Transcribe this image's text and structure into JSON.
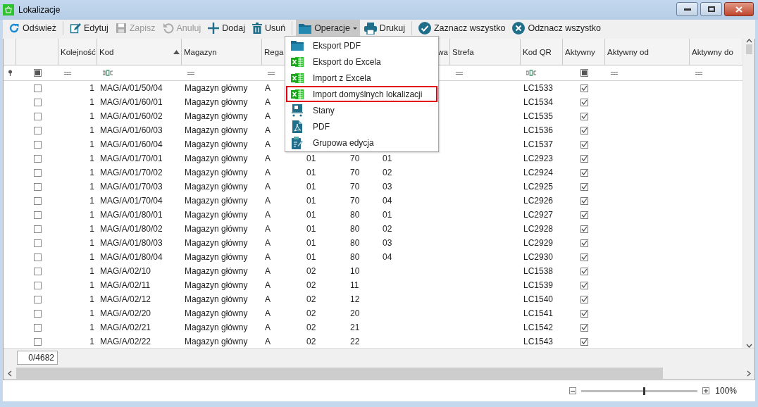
{
  "window": {
    "title": "Lokalizacje"
  },
  "toolbar": [
    {
      "kind": "button",
      "label": "Odśwież",
      "disabled": false
    },
    {
      "kind": "separator"
    },
    {
      "kind": "button",
      "label": "Edytuj",
      "disabled": false
    },
    {
      "kind": "button",
      "label": "Zapisz",
      "disabled": true
    },
    {
      "kind": "button",
      "label": "Anuluj",
      "disabled": true
    },
    {
      "kind": "button",
      "label": "Dodaj",
      "disabled": false
    },
    {
      "kind": "button",
      "label": "Usuń",
      "disabled": false
    },
    {
      "kind": "separator"
    },
    {
      "kind": "dropdown",
      "label": "Operacje",
      "disabled": false,
      "open": true
    },
    {
      "kind": "button",
      "label": "Drukuj",
      "disabled": false
    },
    {
      "kind": "separator"
    },
    {
      "kind": "button",
      "label": "Zaznacz wszystko",
      "disabled": false
    },
    {
      "kind": "button",
      "label": "Odznacz wszystko",
      "disabled": false
    }
  ],
  "menu": [
    {
      "label": "Eksport PDF",
      "selected": false
    },
    {
      "label": "Eksport do Excela",
      "selected": false
    },
    {
      "label": "Import z Excela",
      "selected": false
    },
    {
      "label": "Import domyślnych lokalizacji",
      "selected": true
    },
    {
      "label": "Stany",
      "selected": false
    },
    {
      "label": "PDF",
      "selected": false
    },
    {
      "label": "Grupowa edycja",
      "selected": false
    }
  ],
  "table": {
    "columns": [
      {
        "kind": "checkbox",
        "filter_indeterminate": true
      },
      {
        "kind": "number",
        "label": "Kolejność"
      },
      {
        "kind": "text",
        "label": "Kod",
        "sorted": true
      },
      {
        "kind": "text",
        "label": "Magazyn"
      },
      {
        "kind": "text",
        "label": "Rega"
      },
      {
        "kind": "text"
      },
      {
        "kind": "text"
      },
      {
        "kind": "text",
        "label": "wa"
      },
      {
        "kind": "text",
        "label": "Strefa"
      },
      {
        "kind": "text",
        "label": "Kod QR"
      },
      {
        "kind": "checkbox",
        "label": "Aktywny",
        "filter_indeterminate": true
      },
      {
        "kind": "text",
        "label": "Aktywny od"
      },
      {
        "kind": "text",
        "label": "Aktywny do"
      }
    ],
    "rows": [
      {
        "cells": [
          false,
          "1",
          "MAG/A/01/50/04",
          "Magazyn główny",
          "A",
          null,
          null,
          null,
          null,
          "LC1533",
          true
        ]
      },
      {
        "cells": [
          false,
          "1",
          "MAG/A/01/60/01",
          "Magazyn główny",
          "A",
          null,
          null,
          null,
          null,
          "LC1534",
          true
        ]
      },
      {
        "cells": [
          false,
          "1",
          "MAG/A/01/60/02",
          "Magazyn główny",
          "A",
          null,
          null,
          null,
          null,
          "LC1535",
          true
        ]
      },
      {
        "cells": [
          false,
          "1",
          "MAG/A/01/60/03",
          "Magazyn główny",
          "A",
          null,
          null,
          null,
          null,
          "LC1536",
          true
        ]
      },
      {
        "cells": [
          false,
          "1",
          "MAG/A/01/60/04",
          "Magazyn główny",
          "A",
          null,
          null,
          null,
          null,
          "LC1537",
          true
        ]
      },
      {
        "cells": [
          false,
          "1",
          "MAG/A/01/70/01",
          "Magazyn główny",
          "A",
          "01",
          "70",
          "01",
          null,
          "LC2923",
          true
        ]
      },
      {
        "cells": [
          false,
          "1",
          "MAG/A/01/70/02",
          "Magazyn główny",
          "A",
          "01",
          "70",
          "02",
          null,
          "LC2924",
          true
        ]
      },
      {
        "cells": [
          false,
          "1",
          "MAG/A/01/70/03",
          "Magazyn główny",
          "A",
          "01",
          "70",
          "03",
          null,
          "LC2925",
          true
        ]
      },
      {
        "cells": [
          false,
          "1",
          "MAG/A/01/70/04",
          "Magazyn główny",
          "A",
          "01",
          "70",
          "04",
          null,
          "LC2926",
          true
        ]
      },
      {
        "cells": [
          false,
          "1",
          "MAG/A/01/80/01",
          "Magazyn główny",
          "A",
          "01",
          "80",
          "01",
          null,
          "LC2927",
          true
        ]
      },
      {
        "cells": [
          false,
          "1",
          "MAG/A/01/80/02",
          "Magazyn główny",
          "A",
          "01",
          "80",
          "02",
          null,
          "LC2928",
          true
        ]
      },
      {
        "cells": [
          false,
          "1",
          "MAG/A/01/80/03",
          "Magazyn główny",
          "A",
          "01",
          "80",
          "03",
          null,
          "LC2929",
          true
        ]
      },
      {
        "cells": [
          false,
          "1",
          "MAG/A/01/80/04",
          "Magazyn główny",
          "A",
          "01",
          "80",
          "04",
          null,
          "LC2930",
          true
        ]
      },
      {
        "cells": [
          false,
          "1",
          "MAG/A/02/10",
          "Magazyn główny",
          "A",
          "02",
          "10",
          null,
          null,
          "LC1538",
          true
        ]
      },
      {
        "cells": [
          false,
          "1",
          "MAG/A/02/11",
          "Magazyn główny",
          "A",
          "02",
          "11",
          null,
          null,
          "LC1539",
          true
        ]
      },
      {
        "cells": [
          false,
          "1",
          "MAG/A/02/12",
          "Magazyn główny",
          "A",
          "02",
          "12",
          null,
          null,
          "LC1540",
          true
        ]
      },
      {
        "cells": [
          false,
          "1",
          "MAG/A/02/20",
          "Magazyn główny",
          "A",
          "02",
          "20",
          null,
          null,
          "LC1541",
          true
        ]
      },
      {
        "cells": [
          false,
          "1",
          "MAG/A/02/21",
          "Magazyn główny",
          "A",
          "02",
          "21",
          null,
          null,
          "LC1542",
          true
        ]
      },
      {
        "cells": [
          false,
          "1",
          "MAG/A/02/22",
          "Magazyn główny",
          "A",
          "02",
          "22",
          null,
          null,
          "LC1543",
          true
        ]
      }
    ]
  },
  "record_count": "0/4682",
  "zoom": {
    "level": 0.54,
    "reading": "100%"
  }
}
